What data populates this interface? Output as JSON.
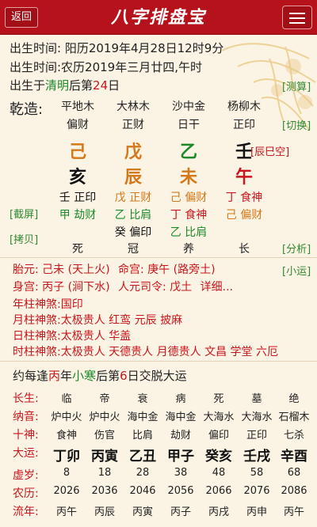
{
  "header": {
    "back_label": "返回",
    "title": "八字排盘宝"
  },
  "birth": {
    "solar": "出生时间: 阳历2019年4月28日12时9分",
    "lunar": "出生时间:农历2019年三月廿四,午时",
    "term_prefix": "出生于",
    "term_name": "清明",
    "term_mid": "后第",
    "term_day": "24",
    "term_suffix": "日"
  },
  "side_links": {
    "measure": "[测算]",
    "switch": "[切换]",
    "screenshot": "[截屏]",
    "copy": "[拷贝]",
    "analysis": "[分析]",
    "xiaoyun": "[小运]"
  },
  "chart_label": "乾造:",
  "pillars": [
    {
      "nayin": "平地木",
      "shishen": "偏财",
      "gan": "己",
      "gan_color": "#d4781a",
      "zhi": "亥",
      "zhi_color": "#111111",
      "hidden": [
        {
          "t": "壬 正印",
          "c": "#111111"
        },
        {
          "t": "甲 劫财",
          "c": "#1a8a2a"
        }
      ],
      "state": "死"
    },
    {
      "nayin": "大林木",
      "shishen": "正财",
      "gan": "戊",
      "gan_color": "#d4781a",
      "zhi": "辰",
      "zhi_color": "#d4781a",
      "hidden": [
        {
          "t": "戊 正财",
          "c": "#d4781a"
        },
        {
          "t": "乙 比肩",
          "c": "#1a8a2a"
        },
        {
          "t": "癸 偏印",
          "c": "#111111"
        }
      ],
      "state": "冠"
    },
    {
      "nayin": "沙中金",
      "shishen": "日干",
      "gan": "乙",
      "gan_color": "#1a8a2a",
      "zhi": "未",
      "zhi_color": "#d4781a",
      "hidden": [
        {
          "t": "己 偏财",
          "c": "#d4781a"
        },
        {
          "t": "丁 食神",
          "c": "#c8161d"
        },
        {
          "t": "乙 比肩",
          "c": "#1a8a2a"
        }
      ],
      "state": "养"
    },
    {
      "nayin": "杨柳木",
      "shishen": "正印",
      "gan": "壬",
      "gan_color": "#111111",
      "zhi": "午",
      "zhi_color": "#c8161d",
      "hidden": [
        {
          "t": "丁 食神",
          "c": "#c8161d"
        },
        {
          "t": "己 偏财",
          "c": "#d4781a"
        }
      ],
      "state": "长"
    }
  ],
  "kongwang": "[辰巳空]",
  "palaces": {
    "taiyuan_label": "胎元:",
    "taiyuan_value": "己未 (天上火)",
    "minggong_label": "命宫:",
    "minggong_value": "庚午 (路旁土)",
    "shengong_label": "身宫:",
    "shengong_value": "丙子 (涧下水)",
    "siling_label": "人元司令:",
    "siling_value": "戊土",
    "detail": "详细..."
  },
  "shensha": [
    {
      "label": "年柱神煞:",
      "value": "国印"
    },
    {
      "label": "月柱神煞:",
      "value": "太极贵人 红鸾 元辰 披麻"
    },
    {
      "label": "日柱神煞:",
      "value": "太极贵人 华盖"
    },
    {
      "label": "时柱神煞:",
      "value": "太极贵人 天德贵人 月德贵人 文昌 学堂 六厄"
    }
  ],
  "dayun_intro": {
    "p1": "约每逢",
    "year": "丙",
    "p2": "年",
    "term": "小寒",
    "p3": "后第",
    "day": "6",
    "p4": "日交脱大运"
  },
  "table": {
    "labels": {
      "changsheng": "长生:",
      "nayin": "纳音:",
      "shishen": "十神:",
      "dayun": "大运:",
      "xusui": "虚岁:",
      "year": "农历:",
      "liunian": "流年:"
    },
    "changsheng": [
      "临",
      "帝",
      "衰",
      "病",
      "死",
      "墓",
      "绝"
    ],
    "nayin": [
      "炉中火",
      "炉中火",
      "海中金",
      "海中金",
      "大海水",
      "大海水",
      "石榴木"
    ],
    "shishen": [
      "食神",
      "伤官",
      "比肩",
      "劫财",
      "偏印",
      "正印",
      "七杀"
    ],
    "dayun": [
      "丁卯",
      "丙寅",
      "乙丑",
      "甲子",
      "癸亥",
      "壬戌",
      "辛酉"
    ],
    "xusui": [
      "8",
      "18",
      "28",
      "38",
      "48",
      "58",
      "68"
    ],
    "year": [
      "2026",
      "2036",
      "2046",
      "2056",
      "2066",
      "2076",
      "2086"
    ],
    "liunian": [
      "丙午",
      "丙辰",
      "丙寅",
      "丙子",
      "丙戌",
      "丙申",
      "丙午"
    ]
  }
}
